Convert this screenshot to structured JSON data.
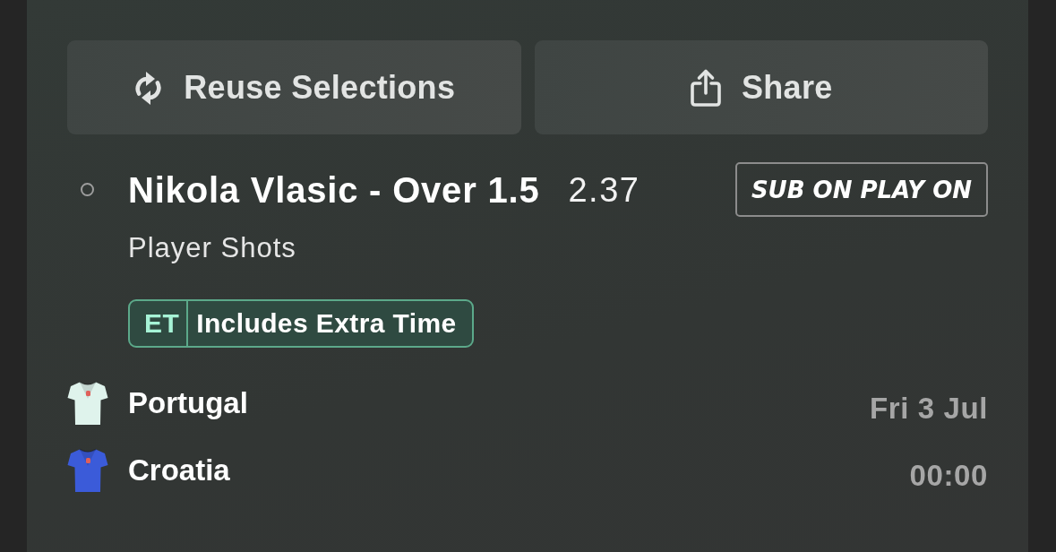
{
  "actions": [
    {
      "kind": "reuse",
      "label": "Reuse Selections"
    },
    {
      "kind": "share",
      "label": "Share"
    }
  ],
  "selection": {
    "settled": false,
    "name": "Nikola Vlasic - Over 1.5",
    "odds": "2.37",
    "promo": "SUB ON PLAY ON",
    "market": "Player Shots",
    "tag": {
      "code": "ET",
      "label": "Includes Extra Time"
    }
  },
  "event": {
    "teams": [
      {
        "name": "Portugal",
        "color": "#dff3ec"
      },
      {
        "name": "Croatia",
        "color": "#3b5bd9"
      }
    ],
    "date": "Fri 3 Jul",
    "time": "00:00"
  }
}
